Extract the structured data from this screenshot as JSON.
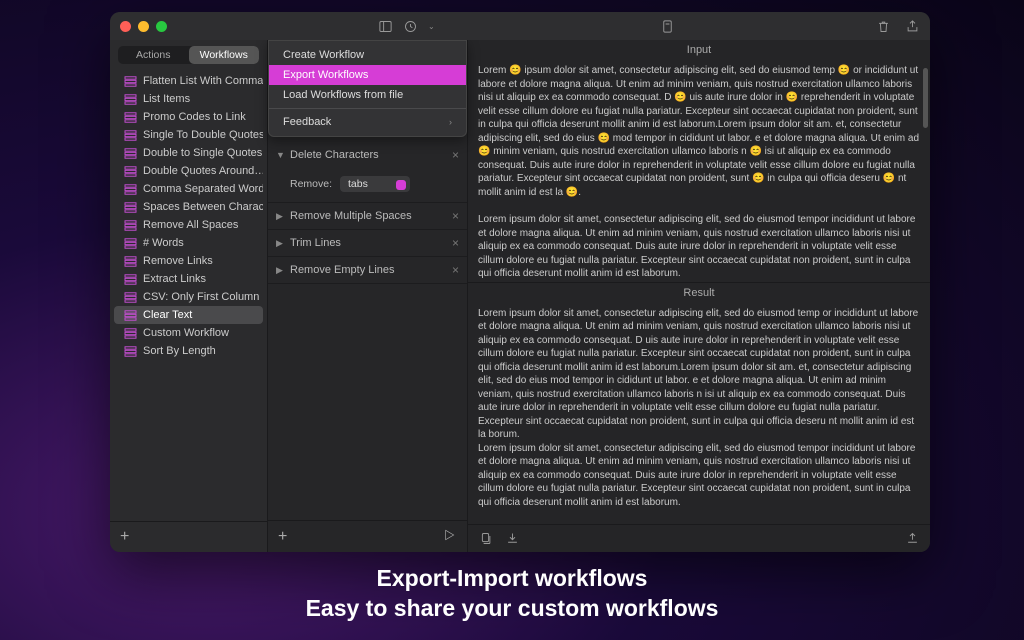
{
  "segmented": {
    "actions": "Actions",
    "workflows": "Workflows"
  },
  "sidebar_items": [
    "Flatten List With Commas",
    "List Items",
    "Promo Codes to Link",
    "Single To Double Quotes",
    "Double to Single Quotes",
    "Double Quotes Around…",
    "Comma Separated Words",
    "Spaces Between Charact…",
    "Remove All Spaces",
    "# Words",
    "Remove Links",
    "Extract Links",
    "CSV: Only First Column",
    "Clear Text",
    "Custom Workflow",
    "Sort By Length"
  ],
  "sidebar_selected_index": 13,
  "menu": {
    "create": "Create Workflow",
    "export": "Export Workflows",
    "load": "Load Workflows from file",
    "feedback": "Feedback"
  },
  "steps": {
    "delete_chars": "Delete Characters",
    "remove_label": "Remove:",
    "remove_value": "tabs",
    "remove_multiple": "Remove Multiple Spaces",
    "trim_lines": "Trim Lines",
    "remove_empty": "Remove Empty Lines"
  },
  "panels": {
    "input_title": "Input",
    "result_title": "Result"
  },
  "input_text_1": "Lorem 😊 ipsum dolor sit amet, consectetur adipiscing elit, sed do eiusmod temp 😊 or incididunt ut labore et dolore magna aliqua. Ut enim ad minim veniam, quis nostrud exercitation ullamco laboris nisi ut aliquip ex ea commodo  consequat. D 😊 uis aute irure dolor in 😊 reprehenderit in voluptate velit esse cillum dolore eu fugiat nulla pariatur. Excepteur sint occaecat cupidatat non proident, sunt in culpa qui officia deserunt mollit anim id est laborum.Lorem ipsum dolor sit am.   et, consectetur adipiscing elit, sed do eius 😊 mod tempor in    cididunt ut labor.  e et dolore magna aliqua. Ut enim ad 😊 minim veniam, quis nostrud exercitation ullamco laboris n 😊 isi ut aliquip ex ea commodo consequat. Duis aute irure dolor in reprehenderit in voluptate velit esse cillum dolore eu fugiat nulla pariatur. Excepteur sint occaecat cupidatat non   proident, sunt 😊 in culpa qui officia deseru 😊 nt mollit anim id est la 😊.",
  "input_text_2": "Lorem ipsum dolor sit amet, consectetur adipiscing elit, sed do eiusmod tempor incididunt ut labore et dolore magna aliqua. Ut enim ad minim veniam, quis nostrud exercitation ullamco laboris nisi ut aliquip ex ea commodo consequat. Duis aute irure dolor in reprehenderit in voluptate velit esse cillum dolore eu fugiat nulla pariatur. Excepteur sint occaecat cupidatat non proident, sunt in culpa qui officia deserunt mollit anim id est laborum.",
  "result_text_1": "Lorem ipsum dolor sit amet, consectetur adipiscing elit, sed do eiusmod temp or incididunt ut labore et dolore magna aliqua. Ut enim ad minim veniam, quis nostrud exercitation ullamco laboris nisi ut aliquip ex ea commodo consequat. D uis aute irure dolor in reprehenderit in voluptate velit esse cillum dolore eu fugiat nulla pariatur. Excepteur sint occaecat cupidatat non proident, sunt in culpa qui officia deserunt mollit anim id est laborum.Lorem ipsum dolor sit am. et, consectetur adipiscing elit, sed do eius mod tempor in cididunt ut labor. e et dolore magna aliqua. Ut enim ad minim veniam, quis nostrud exercitation ullamco laboris n isi ut aliquip ex ea commodo consequat. Duis aute irure dolor in reprehenderit in voluptate velit esse cillum dolore eu fugiat nulla pariatur. Excepteur sint occaecat cupidatat non proident, sunt in culpa qui officia deseru nt mollit anim id est la borum.",
  "result_text_2": "Lorem ipsum dolor sit amet, consectetur adipiscing elit, sed do eiusmod tempor incididunt ut labore et dolore magna aliqua. Ut enim ad minim veniam, quis nostrud exercitation ullamco laboris nisi ut aliquip ex ea commodo consequat. Duis aute irure dolor in reprehenderit in voluptate velit esse cillum dolore eu fugiat nulla pariatur. Excepteur sint occaecat cupidatat non proident, sunt in culpa qui officia deserunt mollit anim id est laborum.",
  "caption_line1": "Export-Import workflows",
  "caption_line2": "Easy to share your custom workflows"
}
